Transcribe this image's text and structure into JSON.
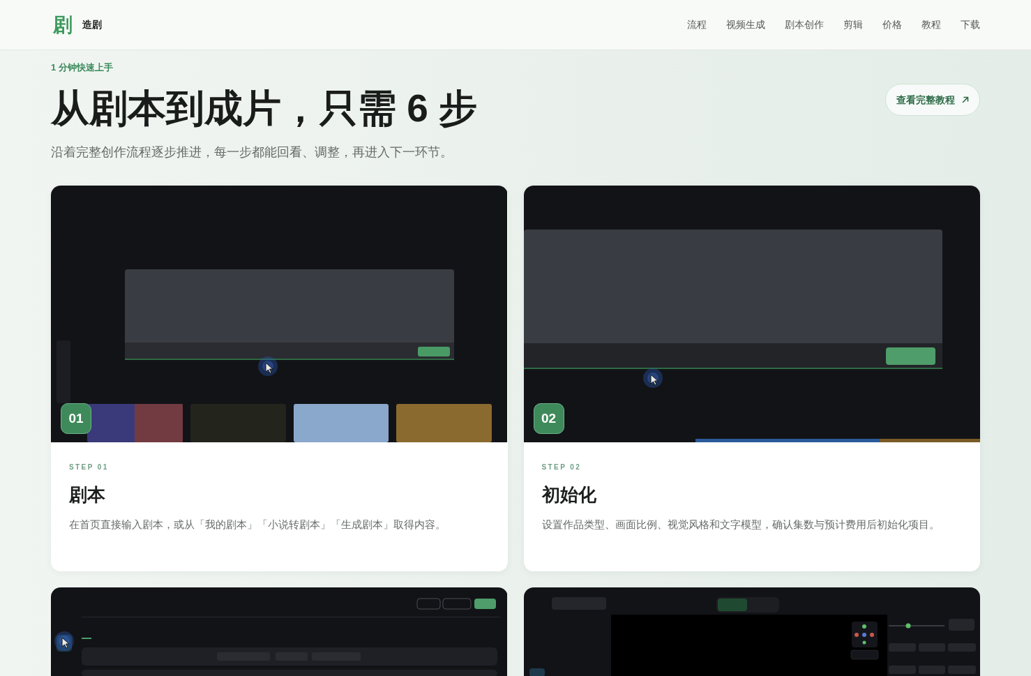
{
  "nav": {
    "logo_mark": "剧",
    "brand": "造剧",
    "links": [
      "流程",
      "视频生成",
      "剧本创作",
      "剪辑",
      "价格",
      "教程",
      "下载"
    ]
  },
  "hero": {
    "eyebrow": "1 分钟快速上手",
    "title": "从剧本到成片，只需 6 步",
    "subtitle": "沿着完整创作流程逐步推进，每一步都能回看、调整，再进入下一环节。",
    "tutorial_button": "查看完整教程"
  },
  "steps": [
    {
      "kind": "home",
      "number": "01",
      "step_label": "STEP 01",
      "title": "剧本",
      "description": "在首页直接输入剧本，或从「我的剧本」「小说转剧本」「生成剧本」取得内容。"
    },
    {
      "kind": "zoom",
      "number": "02",
      "step_label": "STEP 02",
      "title": "初始化",
      "description": "设置作品类型、画面比例、视觉风格和文字模型，确认集数与预计费用后初始化项目。"
    },
    {
      "kind": "editor"
    },
    {
      "kind": "scene3d"
    }
  ]
}
